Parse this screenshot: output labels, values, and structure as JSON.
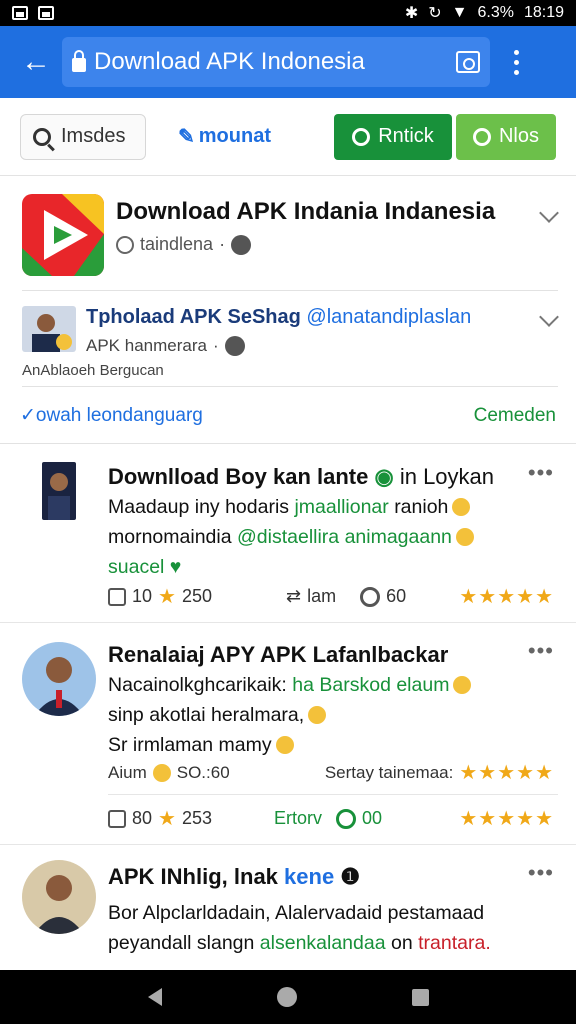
{
  "status_bar": {
    "battery": "6.3%",
    "time": "18:19"
  },
  "app_bar": {
    "url_title": "Download APK Indonesia"
  },
  "toolbar": {
    "search_label": "Imsdes",
    "mount_label": "mounat",
    "refresh_label": "Rntick",
    "nlos_label": "Nlos"
  },
  "app": {
    "title": "Download APK Indania Indanesia",
    "meta": "taindlena",
    "dot": "·"
  },
  "author": {
    "name": "Tpholaad APK SeShag",
    "handle": "@lanatandiplaslan",
    "sub": "APK hanmerara",
    "caption": "AnAblaoeh Bergucan"
  },
  "lang": {
    "link": "owah leondanguarg",
    "action": "Cemeden"
  },
  "comments": [
    {
      "title_main": "Downlload Boy kan lante",
      "title_tail": "in Loykan",
      "line1_a": "Maadaup iny hodaris",
      "line1_b": "jmaallionar",
      "line1_c": "ranioh",
      "line2_a": "mornomaindia",
      "line2_b": "@distaellira  animagaann",
      "line3": "suacel",
      "likes": "10",
      "stars_count": "250",
      "share_label": "lam",
      "comments_count": "60",
      "rating_stars": "★★★★★",
      "more": "•••"
    },
    {
      "title": "Renalaiaj APY APK Lafanlbackar",
      "line1_a": "Nacainolkghcarikaik:",
      "line1_b": "ha Barskod elaum",
      "line2": "sinp akotlai heralmara,",
      "line3": "Sr irmlaman mamy",
      "meta_left": "Aium",
      "meta_value": "SO.:60",
      "meta_right": "Sertay tainemaa:",
      "meta_stars": "★★★★★",
      "likes": "80",
      "stars_count": "253",
      "action": "Ertorv",
      "comments_count": "00",
      "rating_stars": "★★★★★",
      "more": "•••"
    },
    {
      "title_main": "APK INhlig, lnak",
      "title_blue": "kene",
      "line1": "Bor  Alpclarldadain, Alalervadaid pestamaad",
      "line2_a": "peyandall slangn",
      "line2_b": "alsenkalandaa",
      "line2_c": "on",
      "line2_d": "trantara.",
      "more": "•••"
    }
  ],
  "colors": {
    "primary_blue": "#1f6fe0",
    "green": "#18913a",
    "light_green": "#6cc04a",
    "star": "#f0a818"
  }
}
